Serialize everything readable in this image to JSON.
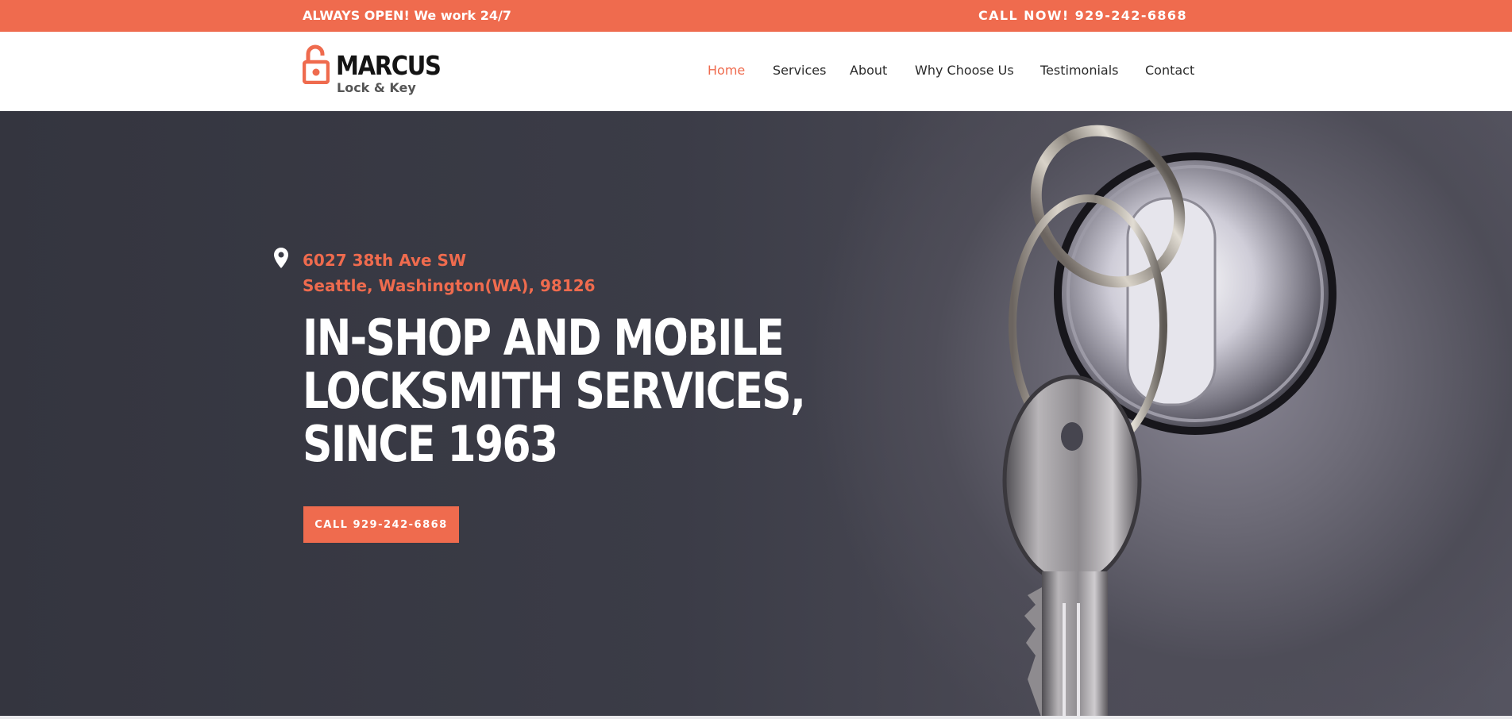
{
  "topbar": {
    "left_text": "ALWAYS OPEN! We work 24/7",
    "right_text": "CALL NOW! 929-242-6868"
  },
  "logo": {
    "brand": "MARCUS",
    "tagline": "Lock & Key",
    "icon": "open-padlock-icon"
  },
  "nav": {
    "items": [
      {
        "label": "Home",
        "active": true
      },
      {
        "label": "Services"
      },
      {
        "label": "About"
      },
      {
        "label": "Why Choose Us"
      },
      {
        "label": "Testimonials"
      },
      {
        "label": "Contact"
      }
    ]
  },
  "hero": {
    "address_icon": "map-pin-icon",
    "address_line1": "6027 38th Ave SW",
    "address_line2": "Seattle, Washington(WA), 98126",
    "headline": [
      "IN-SHOP AND MOBILE",
      "LOCKSMITH SERVICES,",
      "SINCE 1963"
    ],
    "cta_label": "CALL 929-242-6868"
  },
  "colors": {
    "accent": "#ef6b4e",
    "hero_bg": "#3b3c47",
    "text_dark": "#2a2a2a"
  }
}
